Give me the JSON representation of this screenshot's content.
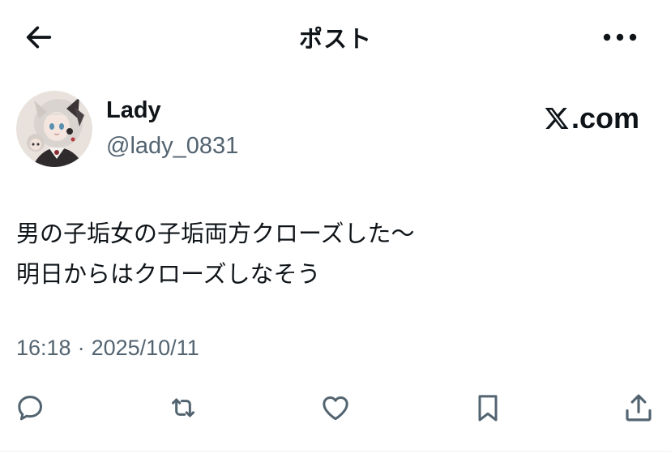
{
  "header": {
    "title": "ポスト",
    "back_icon": "arrow-left-icon",
    "more_icon": "more-horizontal-icon"
  },
  "author": {
    "display_name": "Lady",
    "handle": "@lady_0831",
    "avatar_icon": "anime-girl-avatar"
  },
  "watermark": {
    "logo_text": ".com",
    "logo_icon": "x-logo-icon"
  },
  "post": {
    "lines": [
      "男の子垢女の子垢両方クローズした〜",
      "明日からはクローズしなそう"
    ],
    "time": "16:18",
    "separator": "·",
    "date": "2025/10/11"
  },
  "actions": [
    {
      "name": "reply",
      "icon": "speech-bubble-icon"
    },
    {
      "name": "repost",
      "icon": "repost-arrows-icon"
    },
    {
      "name": "like",
      "icon": "heart-icon"
    },
    {
      "name": "bookmark",
      "icon": "bookmark-icon"
    },
    {
      "name": "share",
      "icon": "share-upload-icon"
    }
  ],
  "colors": {
    "text_primary": "#0f1419",
    "text_secondary": "#536471",
    "icon": "#536471",
    "divider": "#eff3f4"
  }
}
